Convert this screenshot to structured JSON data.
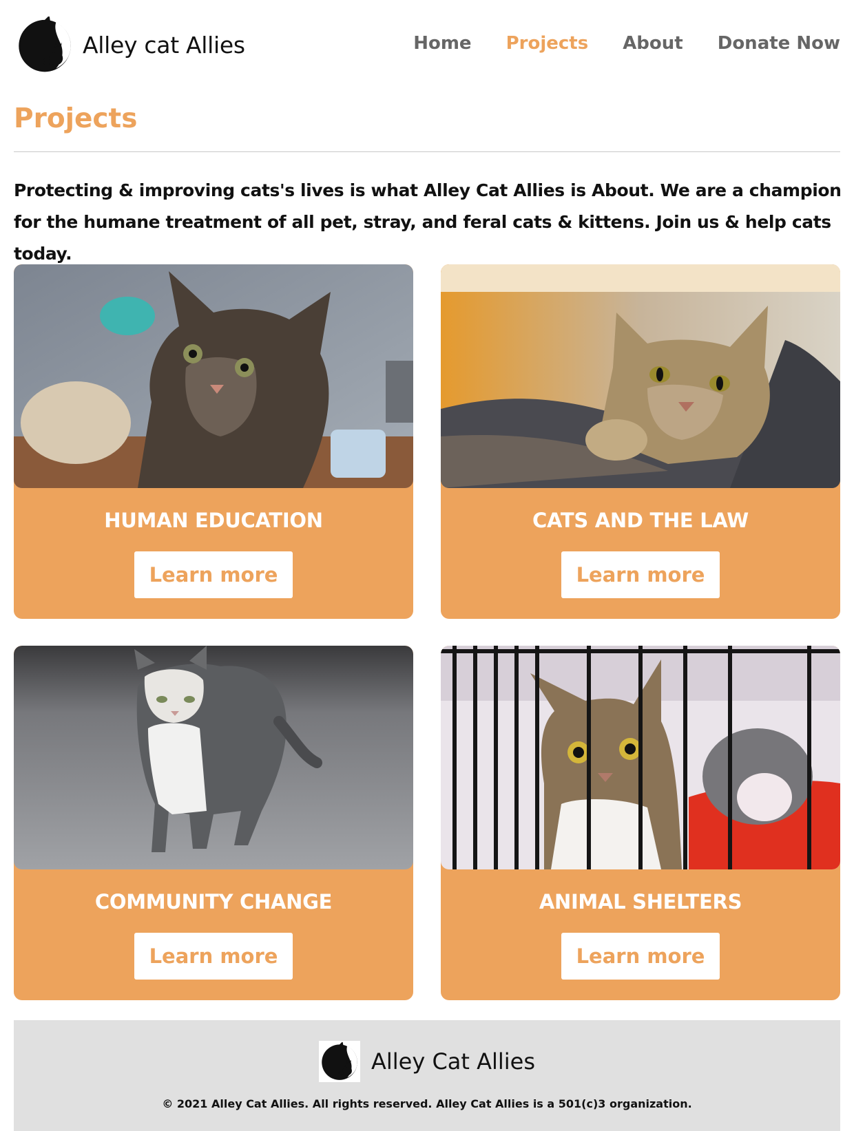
{
  "header": {
    "brand": "Alley cat Allies",
    "logo_icon": "cat-silhouette-logo-icon",
    "nav": [
      {
        "label": "Home"
      },
      {
        "label": "Projects",
        "active": true
      },
      {
        "label": "About"
      },
      {
        "label": "Donate Now"
      }
    ]
  },
  "page": {
    "title": "Projects",
    "intro": "Protecting & improving cats's lives is what Alley Cat Allies is About. We are a champion for the humane treatment of all pet, stray, and feral cats & kittens. Join us & help cats today."
  },
  "cards": [
    {
      "title": "HUMAN EDUCATION",
      "button": "Learn more",
      "image": "tabby-kitten-photo"
    },
    {
      "title": "CATS AND THE LAW",
      "button": "Learn more",
      "image": "tabby-cat-in-basket-photo"
    },
    {
      "title": "COMMUNITY CHANGE",
      "button": "Learn more",
      "image": "walking-street-cat-photo"
    },
    {
      "title": "ANIMAL SHELTERS",
      "button": "Learn more",
      "image": "cat-in-cage-photo"
    }
  ],
  "footer": {
    "brand": "Alley Cat Allies",
    "copyright": "© 2021 Alley Cat Allies. All rights reserved. Alley Cat Allies is a 501(c)3 organization."
  },
  "colors": {
    "accent": "#eda35c",
    "nav_text": "#666666",
    "footer_bg": "#e0e0e0"
  }
}
